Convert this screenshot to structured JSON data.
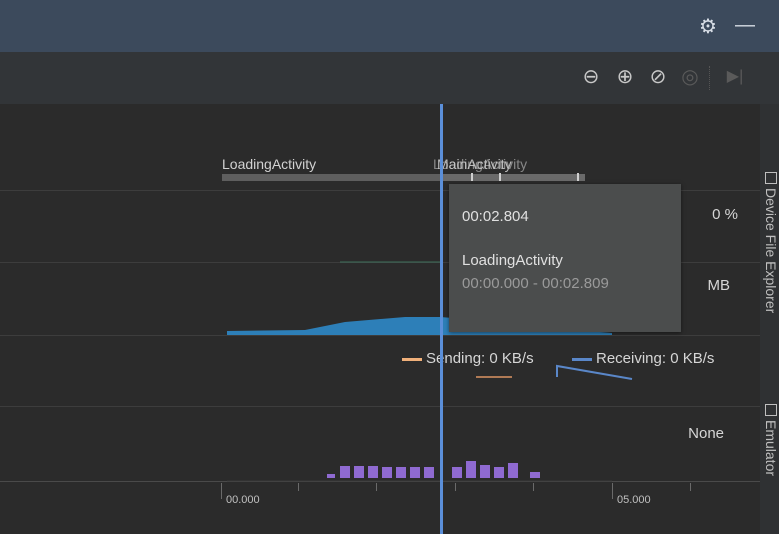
{
  "titlebar": {
    "settings_icon": "gear-icon",
    "minimize_icon": "minimize-icon",
    "settings_glyph": "⚙",
    "minimize_glyph": "—"
  },
  "toolbar": {
    "buttons": [
      {
        "name": "zoom-out-icon",
        "glyph": "⊖",
        "enabled": true
      },
      {
        "name": "zoom-in-icon",
        "glyph": "⊕",
        "enabled": true
      },
      {
        "name": "reset-zoom-icon",
        "glyph": "⊘",
        "enabled": true
      },
      {
        "name": "pause-icon",
        "glyph": "◎",
        "enabled": false
      },
      {
        "name": "jump-to-live-icon",
        "glyph": "▶|",
        "enabled": false
      }
    ]
  },
  "activities": {
    "first_label": "LoadingActivity",
    "second_label": "MainActivity",
    "overlap_label": "LoadingActivity"
  },
  "metrics": {
    "cpu_value": "0 %",
    "memory_value": "MB",
    "event_value": "None"
  },
  "network_legend": {
    "sending": "Sending: 0 KB/s",
    "receiving": "Receiving: 0 KB/s",
    "sending_color": "#f0b07a",
    "receiving_color": "#5a87c9"
  },
  "axis": {
    "labels": [
      "00.000",
      "05.000"
    ]
  },
  "tooltip": {
    "time": "00:02.804",
    "activity": "LoadingActivity",
    "range": "00:00.000 - 00:02.809"
  },
  "side_tabs": {
    "device_file_explorer": "Device File Explorer",
    "emulator": "Emulator"
  },
  "colors": {
    "cursor": "#5b8fd9",
    "memory_fill": "#2d7fb8",
    "energy_bar": "#8f6ad1",
    "tooltip_bg": "#4b4d4d"
  }
}
